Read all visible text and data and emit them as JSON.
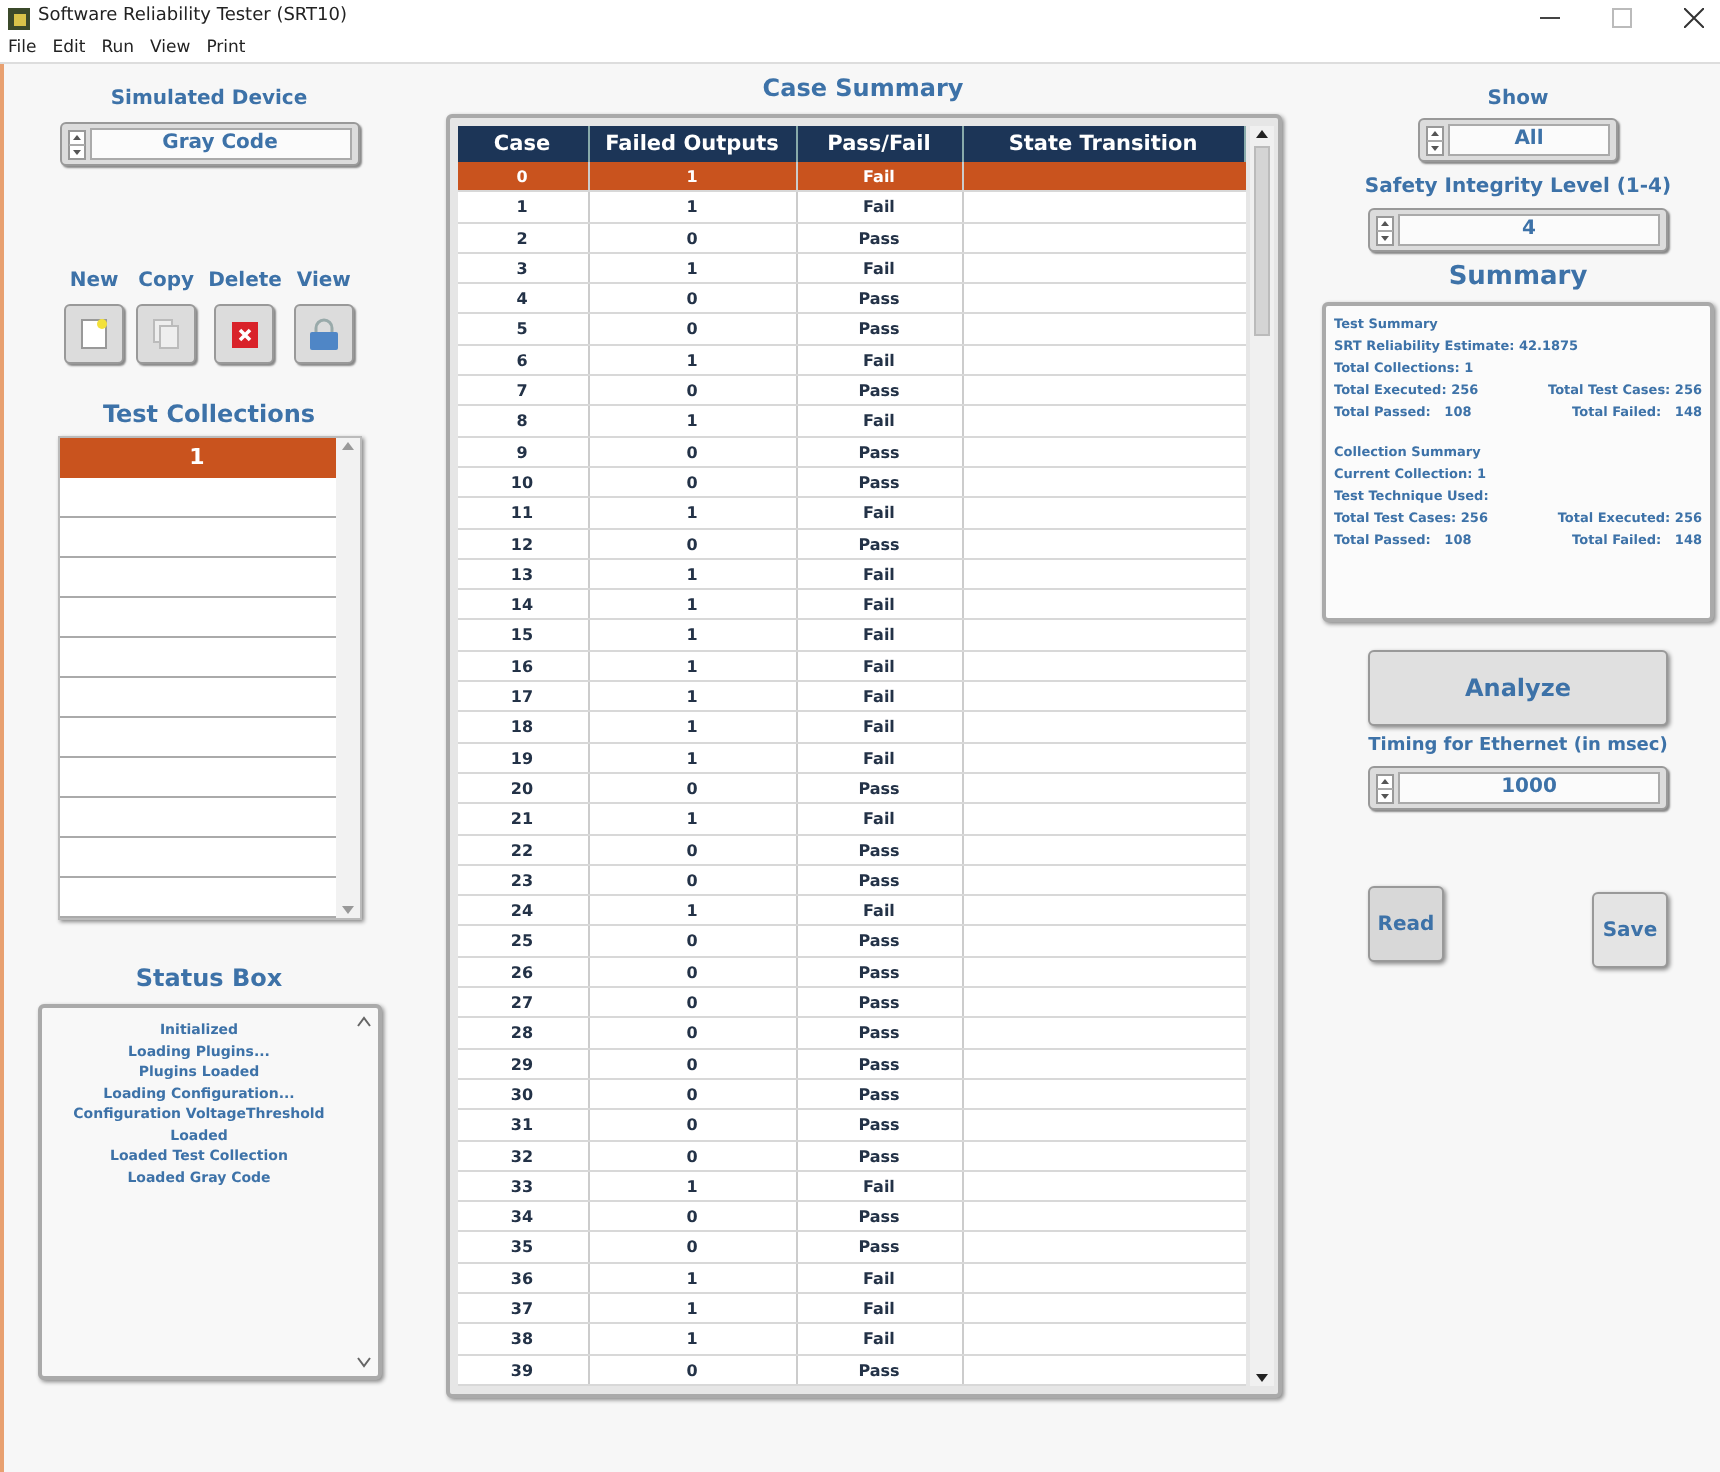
{
  "window": {
    "title": "Software Reliability Tester (SRT10)"
  },
  "menu": [
    "File",
    "Edit",
    "Run",
    "View",
    "Print"
  ],
  "simulated_device": {
    "label": "Simulated Device",
    "value": "Gray Code"
  },
  "actions": [
    {
      "label": "New",
      "kind": "new"
    },
    {
      "label": "Copy",
      "kind": "copy"
    },
    {
      "label": "Delete",
      "kind": "delete"
    },
    {
      "label": "View",
      "kind": "view"
    }
  ],
  "test_collections": {
    "title": "Test Collections",
    "items": [
      {
        "label": "1",
        "selected": true
      }
    ]
  },
  "status_box": {
    "title": "Status Box",
    "lines": [
      "Initialized",
      "Loading Plugins...",
      "Plugins Loaded",
      "Loading Configuration...",
      "Configuration VoltageThreshold",
      "Loaded",
      "Loaded Test Collection",
      "Loaded Gray Code"
    ]
  },
  "case_summary": {
    "title": "Case Summary",
    "columns": [
      "Case",
      "Failed Outputs",
      "Pass/Fail",
      "State Transition"
    ],
    "rows": [
      {
        "case": "0",
        "failed": "1",
        "result": "Fail",
        "selected": true
      },
      {
        "case": "1",
        "failed": "1",
        "result": "Fail",
        "selected": false
      },
      {
        "case": "2",
        "failed": "0",
        "result": "Pass",
        "selected": false
      },
      {
        "case": "3",
        "failed": "1",
        "result": "Fail",
        "selected": false
      },
      {
        "case": "4",
        "failed": "0",
        "result": "Pass",
        "selected": false
      },
      {
        "case": "5",
        "failed": "0",
        "result": "Pass",
        "selected": false
      },
      {
        "case": "6",
        "failed": "1",
        "result": "Fail",
        "selected": false
      },
      {
        "case": "7",
        "failed": "0",
        "result": "Pass",
        "selected": false
      },
      {
        "case": "8",
        "failed": "1",
        "result": "Fail",
        "selected": false
      },
      {
        "case": "9",
        "failed": "0",
        "result": "Pass",
        "selected": false
      },
      {
        "case": "10",
        "failed": "0",
        "result": "Pass",
        "selected": false
      },
      {
        "case": "11",
        "failed": "1",
        "result": "Fail",
        "selected": false
      },
      {
        "case": "12",
        "failed": "0",
        "result": "Pass",
        "selected": false
      },
      {
        "case": "13",
        "failed": "1",
        "result": "Fail",
        "selected": false
      },
      {
        "case": "14",
        "failed": "1",
        "result": "Fail",
        "selected": false
      },
      {
        "case": "15",
        "failed": "1",
        "result": "Fail",
        "selected": false
      },
      {
        "case": "16",
        "failed": "1",
        "result": "Fail",
        "selected": false
      },
      {
        "case": "17",
        "failed": "1",
        "result": "Fail",
        "selected": false
      },
      {
        "case": "18",
        "failed": "1",
        "result": "Fail",
        "selected": false
      },
      {
        "case": "19",
        "failed": "1",
        "result": "Fail",
        "selected": false
      },
      {
        "case": "20",
        "failed": "0",
        "result": "Pass",
        "selected": false
      },
      {
        "case": "21",
        "failed": "1",
        "result": "Fail",
        "selected": false
      },
      {
        "case": "22",
        "failed": "0",
        "result": "Pass",
        "selected": false
      },
      {
        "case": "23",
        "failed": "0",
        "result": "Pass",
        "selected": false
      },
      {
        "case": "24",
        "failed": "1",
        "result": "Fail",
        "selected": false
      },
      {
        "case": "25",
        "failed": "0",
        "result": "Pass",
        "selected": false
      },
      {
        "case": "26",
        "failed": "0",
        "result": "Pass",
        "selected": false
      },
      {
        "case": "27",
        "failed": "0",
        "result": "Pass",
        "selected": false
      },
      {
        "case": "28",
        "failed": "0",
        "result": "Pass",
        "selected": false
      },
      {
        "case": "29",
        "failed": "0",
        "result": "Pass",
        "selected": false
      },
      {
        "case": "30",
        "failed": "0",
        "result": "Pass",
        "selected": false
      },
      {
        "case": "31",
        "failed": "0",
        "result": "Pass",
        "selected": false
      },
      {
        "case": "32",
        "failed": "0",
        "result": "Pass",
        "selected": false
      },
      {
        "case": "33",
        "failed": "1",
        "result": "Fail",
        "selected": false
      },
      {
        "case": "34",
        "failed": "0",
        "result": "Pass",
        "selected": false
      },
      {
        "case": "35",
        "failed": "0",
        "result": "Pass",
        "selected": false
      },
      {
        "case": "36",
        "failed": "1",
        "result": "Fail",
        "selected": false
      },
      {
        "case": "37",
        "failed": "1",
        "result": "Fail",
        "selected": false
      },
      {
        "case": "38",
        "failed": "1",
        "result": "Fail",
        "selected": false
      },
      {
        "case": "39",
        "failed": "0",
        "result": "Pass",
        "selected": false
      }
    ]
  },
  "show": {
    "label": "Show",
    "value": "All"
  },
  "safety_integrity_level": {
    "label": "Safety Integrity Level (1-4)",
    "value": "4"
  },
  "summary": {
    "title": "Summary",
    "sections": [
      {
        "lines": [
          [
            "Test Summary"
          ],
          [
            "SRT Reliability Estimate: 42.1875"
          ],
          [
            "Total Collections: 1"
          ],
          [
            "Total Executed: 256",
            "Total Test Cases: 256"
          ],
          [
            "Total Passed:   108",
            "Total Failed:   148"
          ]
        ]
      },
      {
        "lines": [
          [
            "Collection Summary"
          ],
          [
            "Current Collection: 1"
          ],
          [
            "Test Technique Used:"
          ],
          [
            "Total Test Cases: 256",
            "Total Executed: 256"
          ],
          [
            "Total Passed:   108",
            "Total Failed:   148"
          ]
        ]
      }
    ]
  },
  "analyze_button": "Analyze",
  "timing": {
    "label": "Timing for Ethernet (in msec)",
    "value": "1000"
  },
  "read_button": "Read",
  "save_button": "Save"
}
